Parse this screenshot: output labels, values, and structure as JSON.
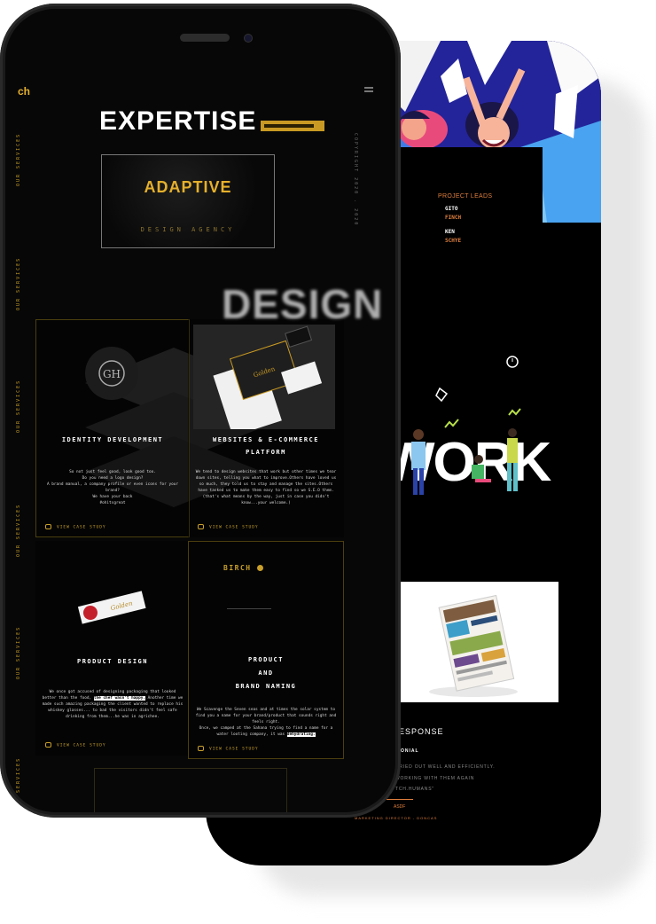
{
  "front": {
    "logo": "ch",
    "side_label": "OUR SERVICES",
    "side_label_5": "SERVICES",
    "copyright_vertical": "COPYRIGHT 2020 . 2020",
    "heading": "EXPERTISE",
    "adaptive": {
      "title": "ADAPTIVE",
      "subtitle": "DESIGN AGENCY"
    },
    "design_word": "DESIGN",
    "cards": [
      {
        "title": "IDENTITY DEVELOPMENT",
        "body": "So not just feel good, look good too.\nDo you need a logo design?\nA brand manual, a company profile or even icons for your brand?\nWe have your back\n#ohitsgreat",
        "case": "VIEW CASE STUDY"
      },
      {
        "title": "WEBSITES & E-COMMERCE PLATFORM",
        "body": "We tend to design websites that work but other times we tear down sites, telling you what to improve.Others have loved us so much, they told us to stay and manage the sites.Others have tasked us to make them easy to find so we S.E.O them. (that's what means by the way, just in case you didn't know...your welcome.)",
        "case": "VIEW CASE STUDY"
      },
      {
        "title": "PRODUCT DESIGN",
        "body_pre": "We once got accused of designing packaging that looked better than the food,",
        "body_hl": "the chef wasn't happy.",
        "body_post": "Another time we made such amazing packaging the client wanted to replace his whiskey glasses... to bad the visitors didn't feel safe drinking from them...he was in agrichee.",
        "case": "VIEW CASE STUDY"
      },
      {
        "title_lines": [
          "PRODUCT",
          "AND",
          "BRAND NAMING"
        ],
        "brand": "BIRCH",
        "body_pre": "We Scavenge the Seven seas and at times the solar system to find you a name for your brand/product that sounds right and feels right.\nOnce, we camped at the Sahana trying to find a name for a water looting company, it was",
        "body_hl": "dehydrating.",
        "case": "VIEW CASE STUDY"
      }
    ]
  },
  "back": {
    "leads_title": "PROJECT LEADS",
    "leads": [
      "GITO",
      "FINCH",
      "KEN",
      "SCHYE"
    ],
    "work_word": "WORK",
    "response_title": "ESPONSE",
    "testimonial_label": "ONIAL",
    "testimonial_lines": [
      "RRIED OUT WELL AND EFFICIENTLY.",
      "WORKING WITH THEM AGAIN",
      "TCH.HUMANS\""
    ],
    "author": "ASDF",
    "role": "MARKETING DIRECTOR - DONCAS",
    "accent": "#e07f3d"
  }
}
